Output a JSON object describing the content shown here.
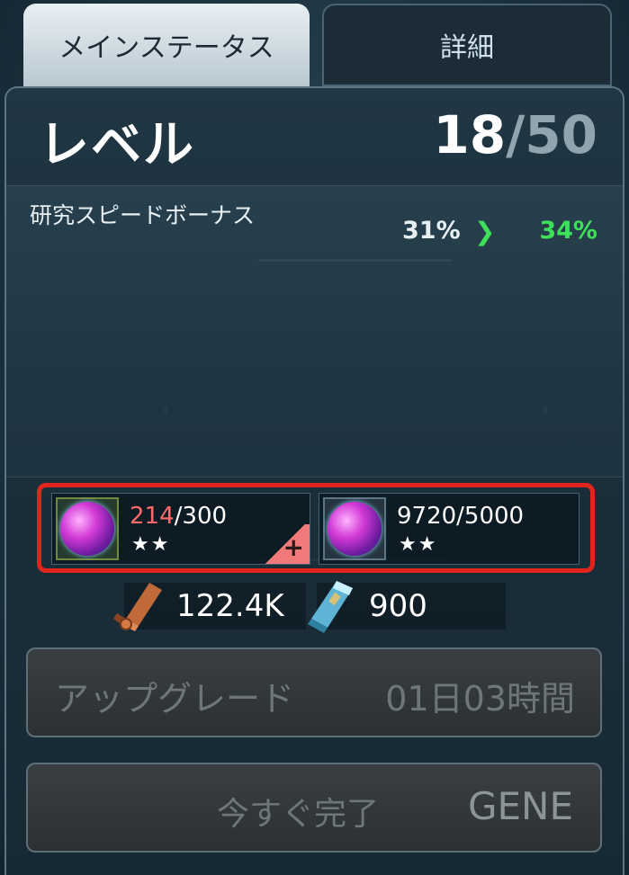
{
  "tabs": {
    "main_label": "メインステータス",
    "detail_label": "詳細"
  },
  "level": {
    "label": "レベル",
    "current": "18",
    "separator": "/",
    "max": "50"
  },
  "bonus": {
    "label": "研究スピードボーナス",
    "current": "31%",
    "arrow": "❯",
    "next": "34%"
  },
  "materials": [
    {
      "icon": "purple-orb-icon",
      "current": "214",
      "required": "/300",
      "stars": "★★",
      "insufficient": true
    },
    {
      "icon": "purple-orb-icon",
      "current": "9720",
      "required": "/5000",
      "stars": "★★",
      "insufficient": false
    }
  ],
  "costs": [
    {
      "icon": "copper-ingot-icon",
      "value": "122.4K"
    },
    {
      "icon": "blue-crystal-icon",
      "value": "900"
    }
  ],
  "upgrade_button": {
    "label": "アップグレード",
    "time": "01日03時間"
  },
  "complete_button": {
    "label": "今すぐ完了",
    "cost": "GENE"
  },
  "colors": {
    "accent_green": "#3ee05a",
    "highlight_red": "#e0261c",
    "insufficient_red": "#ff6b6b"
  }
}
